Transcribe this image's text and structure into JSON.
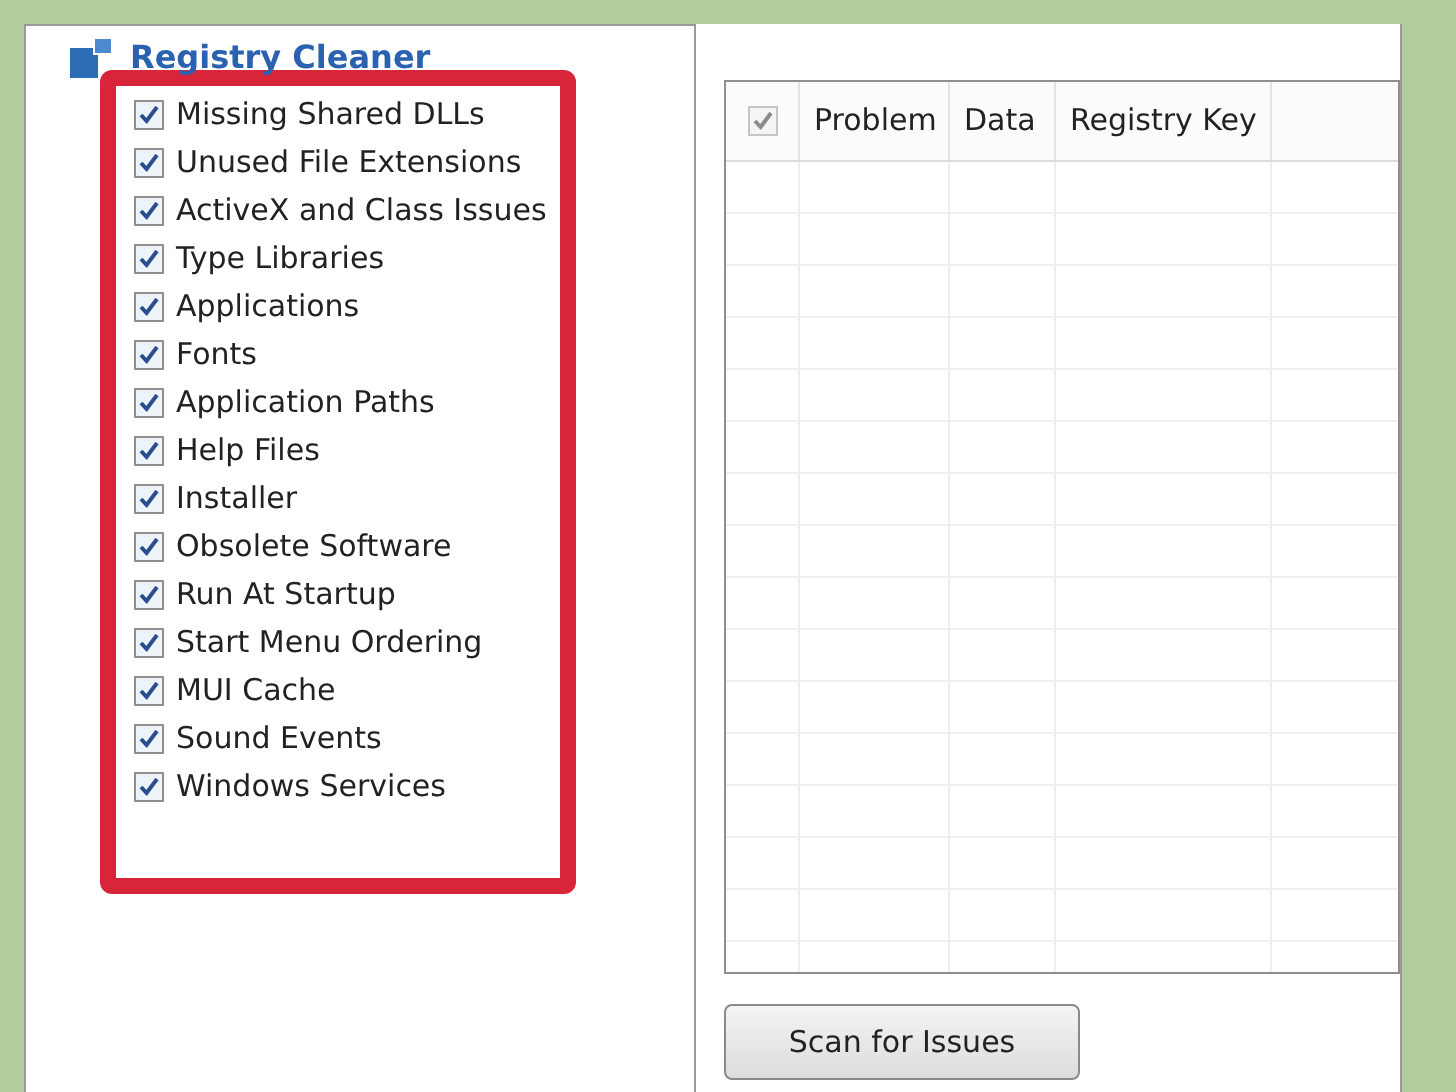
{
  "panel_title": "Registry Cleaner",
  "checklist": [
    {
      "label": "Missing Shared DLLs",
      "checked": true
    },
    {
      "label": "Unused File Extensions",
      "checked": true
    },
    {
      "label": "ActiveX and Class Issues",
      "checked": true
    },
    {
      "label": "Type Libraries",
      "checked": true
    },
    {
      "label": "Applications",
      "checked": true
    },
    {
      "label": "Fonts",
      "checked": true
    },
    {
      "label": "Application Paths",
      "checked": true
    },
    {
      "label": "Help Files",
      "checked": true
    },
    {
      "label": "Installer",
      "checked": true
    },
    {
      "label": "Obsolete Software",
      "checked": true
    },
    {
      "label": "Run At Startup",
      "checked": true
    },
    {
      "label": "Start Menu Ordering",
      "checked": true
    },
    {
      "label": "MUI Cache",
      "checked": true
    },
    {
      "label": "Sound Events",
      "checked": true
    },
    {
      "label": "Windows Services",
      "checked": true
    }
  ],
  "table": {
    "select_all": {
      "checked": true,
      "disabled": true
    },
    "columns": [
      "Problem",
      "Data",
      "Registry Key"
    ]
  },
  "buttons": [
    "Scan for Issues"
  ]
}
